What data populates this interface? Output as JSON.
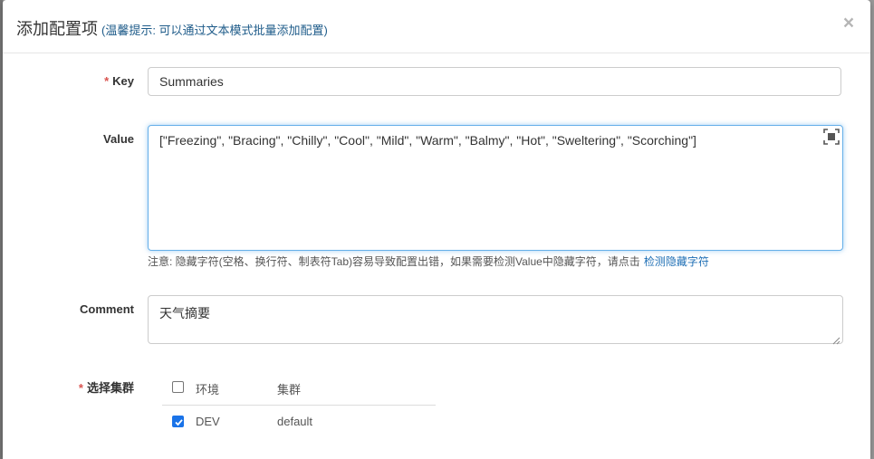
{
  "modal": {
    "title": "添加配置项",
    "tip": "(温馨提示: 可以通过文本模式批量添加配置)",
    "close_label": "×"
  },
  "form": {
    "key_label": "Key",
    "key_value": "Summaries",
    "value_label": "Value",
    "value_text": "[\"Freezing\", \"Bracing\", \"Chilly\", \"Cool\", \"Mild\", \"Warm\", \"Balmy\", \"Hot\", \"Sweltering\", \"Scorching\"]",
    "note_text": "注意: 隐藏字符(空格、换行符、制表符Tab)容易导致配置出错，如果需要检测Value中隐藏字符，请点击",
    "note_link": "检测隐藏字符",
    "comment_label": "Comment",
    "comment_value": "天气摘要",
    "cluster_label": "选择集群",
    "required_mark": "*"
  },
  "cluster_table": {
    "headers": {
      "env": "环境",
      "cluster": "集群"
    },
    "rows": [
      {
        "env": "DEV",
        "cluster": "default",
        "checked": true
      }
    ],
    "header_checked": false
  },
  "colors": {
    "accent": "#1a73e8",
    "required": "#d9534f",
    "link": "#1f6fb5",
    "focus_border": "#66afe9"
  }
}
